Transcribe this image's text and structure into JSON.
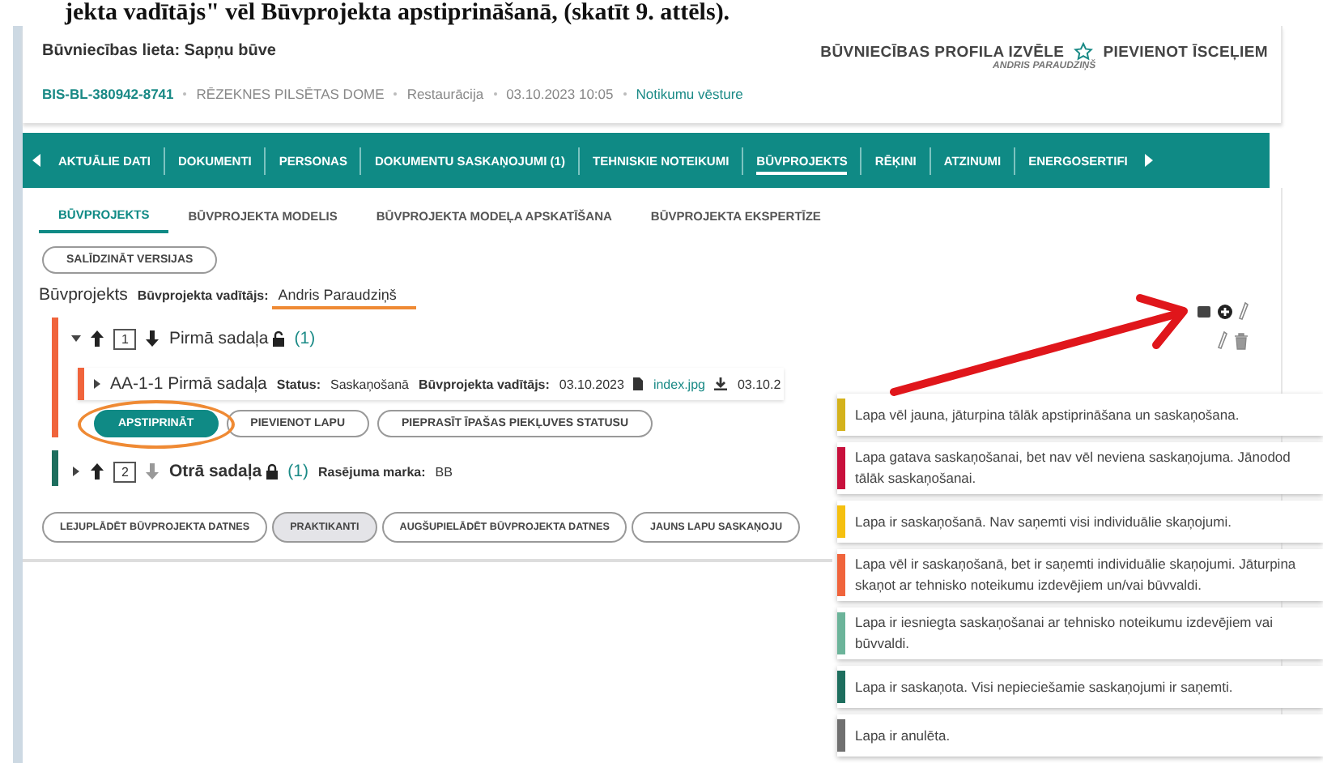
{
  "doc_caption": "jekta vadītājs\" vēl Būvprojekta apstiprināšanā, (skatīt 9. attēls).",
  "header": {
    "title": "Būvniecības lieta: Sapņu būve",
    "case_id": "BIS-BL-380942-8741",
    "meta": [
      "RĒZEKNES PILSĒTAS DOME",
      "Restaurācija",
      "03.10.2023 10:05"
    ],
    "history_link": "Notikumu vēsture",
    "profile_select": "BŪVNIECĪBAS PROFILA IZVĒLE",
    "profile_user": "ANDRIS PARAUDZIŅŠ",
    "add_shortcut": "PIEVIENOT ĪSCEĻIEM"
  },
  "nav": {
    "tabs": [
      {
        "label": "AKTUĀLIE DATI",
        "selected": false
      },
      {
        "label": "DOKUMENTI",
        "selected": false
      },
      {
        "label": "PERSONAS",
        "selected": false
      },
      {
        "label": "DOKUMENTU SASKAŅOJUMI (1)",
        "selected": false
      },
      {
        "label": "TEHNISKIE NOTEIKUMI",
        "selected": false
      },
      {
        "label": "BŪVPROJEKTS",
        "selected": true
      },
      {
        "label": "RĒĶINI",
        "selected": false
      },
      {
        "label": "ATZINUMI",
        "selected": false
      },
      {
        "label": "ENERGOSERTIFI",
        "selected": false
      }
    ]
  },
  "subtabs": [
    {
      "label": "BŪVPROJEKTS",
      "selected": true
    },
    {
      "label": "BŪVPROJEKTA MODELIS",
      "selected": false
    },
    {
      "label": "BŪVPROJEKTA MODEĻA APSKATĪŠANA",
      "selected": false
    },
    {
      "label": "BŪVPROJEKTA EKSPERTĪZE",
      "selected": false
    }
  ],
  "compare_button": "SALĪDZINĀT VERSIJAS",
  "project": {
    "label": "Būvprojekts",
    "manager_label": "Būvprojekta vadītājs:",
    "manager": "Andris Paraudziņš"
  },
  "sections": [
    {
      "number": "1",
      "title": "Pirmā sadaļa",
      "count": "(1)",
      "locked": false,
      "expanded": true,
      "color": "#f0643c",
      "pages": [
        {
          "title": "AA-1-1 Pirmā sadaļa",
          "status_label": "Status:",
          "status": "Saskaņošanā",
          "manager_label": "Būvprojekta vadītājs:",
          "date": "03.10.2023",
          "file": "index.jpg",
          "file_date": "03.10.2",
          "color": "#f0643c"
        }
      ],
      "actions": [
        {
          "label": "APSTIPRINĀT",
          "kind": "primary"
        },
        {
          "label": "PIEVIENOT LAPU",
          "kind": "outline"
        },
        {
          "label": "PIEPRASĪT ĪPAŠAS PIEKĻUVES STATUSU",
          "kind": "outline"
        }
      ]
    },
    {
      "number": "2",
      "title": "Otrā sadaļa",
      "count": "(1)",
      "locked": true,
      "expanded": false,
      "color": "#1e6e5e",
      "mark_label": "Rasējuma marka:",
      "mark": "BB"
    }
  ],
  "bottom_buttons": [
    {
      "label": "LEJUPLĀDĒT BŪVPROJEKTA DATNES",
      "selected": false
    },
    {
      "label": "PRAKTIKANTI",
      "selected": true
    },
    {
      "label": "AUGŠUPIELĀDĒT BŪVPROJEKTA DATNES",
      "selected": false
    },
    {
      "label": "JAUNS LAPU SASKAŅOJU",
      "selected": false
    }
  ],
  "legend": [
    {
      "text": "Lapa vēl jauna, jāturpina tālāk apstiprināšana un saskaņošana.",
      "color": "#d4b21c"
    },
    {
      "text": "Lapa gatava saskaņošanai, bet nav vēl neviena saskaņojuma. Jānodod tālāk saskaņošanai.",
      "color": "#c8103c"
    },
    {
      "text": "Lapa ir saskaņošanā. Nav saņemti visi individuālie skaņojumi.",
      "color": "#f5c010"
    },
    {
      "text": "Lapa vēl ir saskaņošanā, bet ir saņemti individuālie skaņojumi. Jāturpina skaņot ar tehnisko noteikumu izdevējiem un/vai būvvaldi.",
      "color": "#f0643c"
    },
    {
      "text": "Lapa ir iesniegta saskaņošanai ar tehnisko noteikumu izdevējiem vai būvvaldi.",
      "color": "#6cb49a"
    },
    {
      "text": "Lapa ir saskaņota. Visi nepieciešamie saskaņojumi ir saņemti.",
      "color": "#1e6e5e"
    },
    {
      "text": "Lapa ir anulēta.",
      "color": "#707070"
    }
  ]
}
